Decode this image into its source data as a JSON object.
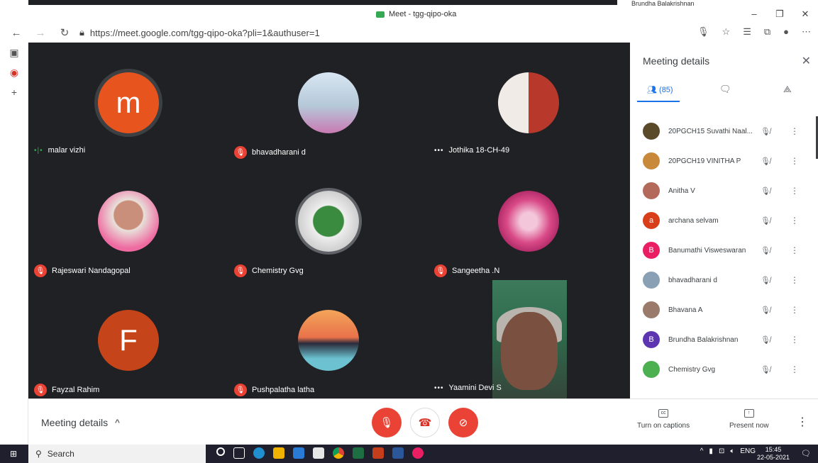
{
  "browser": {
    "tab_title": "Meet - tgg-qipo-oka",
    "url": "https://meet.google.com/tgg-qipo-oka?pli=1&authuser=1",
    "top_thumb_name": "Brundha Balakrishnan"
  },
  "tiles": [
    {
      "name": "malar vizhi",
      "initial": "m",
      "avatar_color": "#e8541e",
      "status": "speaking"
    },
    {
      "name": "bhavadharani d",
      "initial": "",
      "avatar_color": "#9fb3c9",
      "status": "muted"
    },
    {
      "name": "Jothika 18-CH-49",
      "initial": "",
      "avatar_color": "#d9a38c",
      "status": "dots"
    },
    {
      "name": "Rajeswari Nandagopal",
      "initial": "",
      "avatar_color": "#e6b8a0",
      "status": "muted"
    },
    {
      "name": "Chemistry Gvg",
      "initial": "",
      "avatar_color": "#5aa05a",
      "status": "muted"
    },
    {
      "name": "Sangeetha .N",
      "initial": "",
      "avatar_color": "#e07aa3",
      "status": "muted"
    },
    {
      "name": "Fayzal Rahim",
      "initial": "F",
      "avatar_color": "#c5441a",
      "status": "muted"
    },
    {
      "name": "Pushpalatha latha",
      "initial": "",
      "avatar_color": "#e88a3c",
      "status": "muted"
    },
    {
      "name": "Yaamini Devi S",
      "initial": "",
      "avatar_color": "#3d7a5c",
      "status": "dots"
    }
  ],
  "panel": {
    "title": "Meeting details",
    "people_count": "(85)",
    "participants": [
      {
        "name": "20PGCH15 Suvathi Naal...",
        "initial": "",
        "color": "#5a4a2a"
      },
      {
        "name": "20PGCH19 VINITHA P",
        "initial": "",
        "color": "#c88a3a"
      },
      {
        "name": "Anitha V",
        "initial": "",
        "color": "#b46a5a"
      },
      {
        "name": "archana selvam",
        "initial": "a",
        "color": "#d93e1a"
      },
      {
        "name": "Banumathi Visweswaran",
        "initial": "B",
        "color": "#e91e63"
      },
      {
        "name": "bhavadharani d",
        "initial": "",
        "color": "#8aa0b5"
      },
      {
        "name": "Bhavana A",
        "initial": "",
        "color": "#9a7a6a"
      },
      {
        "name": "Brundha Balakrishnan",
        "initial": "B",
        "color": "#5e35b1"
      },
      {
        "name": "Chemistry Gvg",
        "initial": "",
        "color": "#4caf50"
      }
    ]
  },
  "bottom": {
    "meeting_details": "Meeting details",
    "captions": "Turn on captions",
    "present": "Present now"
  },
  "taskbar": {
    "search": "Search",
    "lang": "ENG",
    "time": "15:45",
    "date": "22-05-2021"
  }
}
